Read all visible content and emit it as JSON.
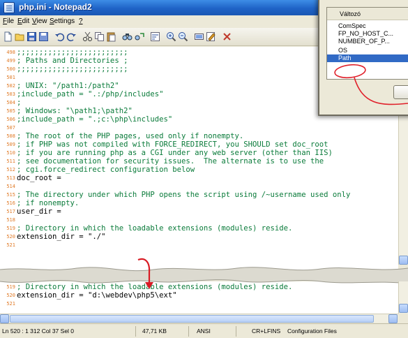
{
  "window": {
    "title": "php.ini - Notepad2"
  },
  "menu": [
    {
      "label": "File",
      "key": "F",
      "rest": "ile"
    },
    {
      "label": "Edit",
      "key": "E",
      "rest": "dit"
    },
    {
      "label": "View",
      "key": "V",
      "rest": "iew"
    },
    {
      "label": "Settings",
      "key": "S",
      "rest": "ettings"
    },
    {
      "label": "?",
      "key": "?",
      "rest": ""
    }
  ],
  "toolbar_icons": [
    "new-file-icon",
    "open-file-icon",
    "save-file-icon",
    "save-as-icon",
    "undo-icon",
    "redo-icon",
    "cut-icon",
    "copy-icon",
    "paste-icon",
    "find-icon",
    "replace-icon",
    "word-wrap-icon",
    "zoom-in-icon",
    "zoom-out-icon",
    "select-scheme-icon",
    "customize-scheme-icon",
    "exit-icon"
  ],
  "editor_top": {
    "lines": [
      {
        "n": "498",
        "t": ";;;;;;;;;;;;;;;;;;;;;;;;;",
        "kind": "comment"
      },
      {
        "n": "499",
        "t": "; Paths and Directories ;",
        "kind": "comment"
      },
      {
        "n": "500",
        "t": ";;;;;;;;;;;;;;;;;;;;;;;;;",
        "kind": "comment"
      },
      {
        "n": "501",
        "t": "",
        "kind": "plain"
      },
      {
        "n": "502",
        "t": "; UNIX: \"/path1:/path2\"",
        "kind": "comment"
      },
      {
        "n": "503",
        "t": ";include_path = \".:/php/includes\"",
        "kind": "comment"
      },
      {
        "n": "504",
        "t": ";",
        "kind": "comment"
      },
      {
        "n": "505",
        "t": "; Windows: \"\\path1;\\path2\"",
        "kind": "comment"
      },
      {
        "n": "506",
        "t": ";include_path = \".;c:\\php\\includes\"",
        "kind": "comment"
      },
      {
        "n": "507",
        "t": "",
        "kind": "plain"
      },
      {
        "n": "508",
        "t": "; The root of the PHP pages, used only if nonempty.",
        "kind": "comment"
      },
      {
        "n": "509",
        "t": "; if PHP was not compiled with FORCE_REDIRECT, you SHOULD set doc_root",
        "kind": "comment"
      },
      {
        "n": "510",
        "t": "; if you are running php as a CGI under any web server (other than IIS)",
        "kind": "comment"
      },
      {
        "n": "511",
        "t": "; see documentation for security issues.  The alternate is to use the",
        "kind": "comment"
      },
      {
        "n": "512",
        "t": "; cgi.force_redirect configuration below",
        "kind": "comment"
      },
      {
        "n": "513",
        "t": "doc_root =",
        "kind": "plain"
      },
      {
        "n": "514",
        "t": "",
        "kind": "plain"
      },
      {
        "n": "515",
        "t": "; The directory under which PHP opens the script using /~username used only",
        "kind": "comment"
      },
      {
        "n": "516",
        "t": "; if nonempty.",
        "kind": "comment"
      },
      {
        "n": "517",
        "t": "user_dir =",
        "kind": "plain"
      },
      {
        "n": "518",
        "t": "",
        "kind": "plain"
      },
      {
        "n": "519",
        "t": "; Directory in which the loadable extensions (modules) reside.",
        "kind": "comment"
      },
      {
        "n": "520",
        "t": "extension_dir = \"./\"",
        "kind": "plain"
      },
      {
        "n": "521",
        "t": "",
        "kind": "plain"
      }
    ]
  },
  "editor_bottom": {
    "lines": [
      {
        "n": "519",
        "t": "; Directory in which the loadable extensions (modules) reside.",
        "kind": "comment"
      },
      {
        "n": "520",
        "t": "extension_dir = \"d:\\webdev\\php5\\ext\"",
        "kind": "plain"
      },
      {
        "n": "521",
        "t": "",
        "kind": "plain"
      }
    ]
  },
  "statusbar": {
    "position": "Ln 520 : 1 312  Col 37  Sel 0",
    "size": "47,71 KB",
    "encoding": "ANSI",
    "line_endings": "CR+LF",
    "insert_mode": "INS",
    "scheme": "Configuration Files"
  },
  "env_dialog": {
    "column_header": "Változó",
    "rows": [
      "ComSpec",
      "FP_NO_HOST_C...",
      "NUMBER_OF_P...",
      "OS",
      "Path"
    ],
    "selected": "Path"
  },
  "colors": {
    "titlebar": "#1f63c6",
    "comment_text": "#0a7b3a",
    "line_numbers": "#e07a26",
    "selection": "#316ac5",
    "annotation": "#e0202a"
  }
}
